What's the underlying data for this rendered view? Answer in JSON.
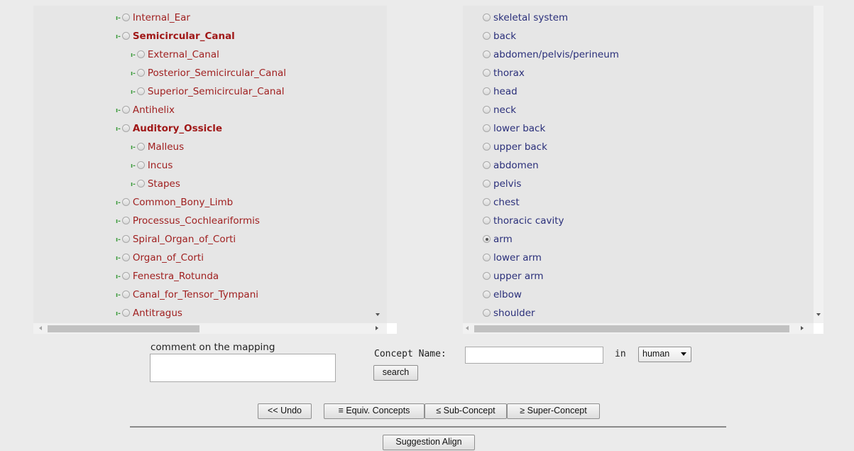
{
  "left_tree": [
    {
      "label": "Internal_Ear",
      "depth": 0,
      "bold": false
    },
    {
      "label": "Semicircular_Canal",
      "depth": 0,
      "bold": true
    },
    {
      "label": "External_Canal",
      "depth": 1,
      "bold": false
    },
    {
      "label": "Posterior_Semicircular_Canal",
      "depth": 1,
      "bold": false
    },
    {
      "label": "Superior_Semicircular_Canal",
      "depth": 1,
      "bold": false
    },
    {
      "label": "Antihelix",
      "depth": 0,
      "bold": false
    },
    {
      "label": "Auditory_Ossicle",
      "depth": 0,
      "bold": true
    },
    {
      "label": "Malleus",
      "depth": 1,
      "bold": false
    },
    {
      "label": "Incus",
      "depth": 1,
      "bold": false
    },
    {
      "label": "Stapes",
      "depth": 1,
      "bold": false
    },
    {
      "label": "Common_Bony_Limb",
      "depth": 0,
      "bold": false
    },
    {
      "label": "Processus_Cochleariformis",
      "depth": 0,
      "bold": false
    },
    {
      "label": "Spiral_Organ_of_Corti",
      "depth": 0,
      "bold": false
    },
    {
      "label": "Organ_of_Corti",
      "depth": 0,
      "bold": false
    },
    {
      "label": "Fenestra_Rotunda",
      "depth": 0,
      "bold": false
    },
    {
      "label": "Canal_for_Tensor_Tympani",
      "depth": 0,
      "bold": false
    },
    {
      "label": "Antitragus",
      "depth": 0,
      "bold": false
    }
  ],
  "right_list": [
    {
      "label": "skeletal system",
      "selected": false
    },
    {
      "label": "back",
      "selected": false
    },
    {
      "label": "abdomen/pelvis/perineum",
      "selected": false
    },
    {
      "label": "thorax",
      "selected": false
    },
    {
      "label": "head",
      "selected": false
    },
    {
      "label": "neck",
      "selected": false
    },
    {
      "label": "lower back",
      "selected": false
    },
    {
      "label": "upper back",
      "selected": false
    },
    {
      "label": "abdomen",
      "selected": false
    },
    {
      "label": "pelvis",
      "selected": false
    },
    {
      "label": "chest",
      "selected": false
    },
    {
      "label": "thoracic cavity",
      "selected": false
    },
    {
      "label": "arm",
      "selected": true
    },
    {
      "label": "lower arm",
      "selected": false
    },
    {
      "label": "upper arm",
      "selected": false
    },
    {
      "label": "elbow",
      "selected": false
    },
    {
      "label": "shoulder",
      "selected": false
    }
  ],
  "tree_connector": "ı-",
  "comment": {
    "label": "comment on the mapping",
    "value": ""
  },
  "search": {
    "label": "Concept Name:",
    "value": "",
    "in_label": "in",
    "scope": "human",
    "button": "search"
  },
  "actions": {
    "undo": "<< Undo",
    "equiv": "≡ Equiv. Concepts",
    "sub": "≤ Sub-Concept",
    "super": "≥ Super-Concept",
    "suggest": "Suggestion Align"
  },
  "colors": {
    "left_text": "#a02020",
    "right_text": "#2a2f7a",
    "connector": "#3a9a3a"
  }
}
